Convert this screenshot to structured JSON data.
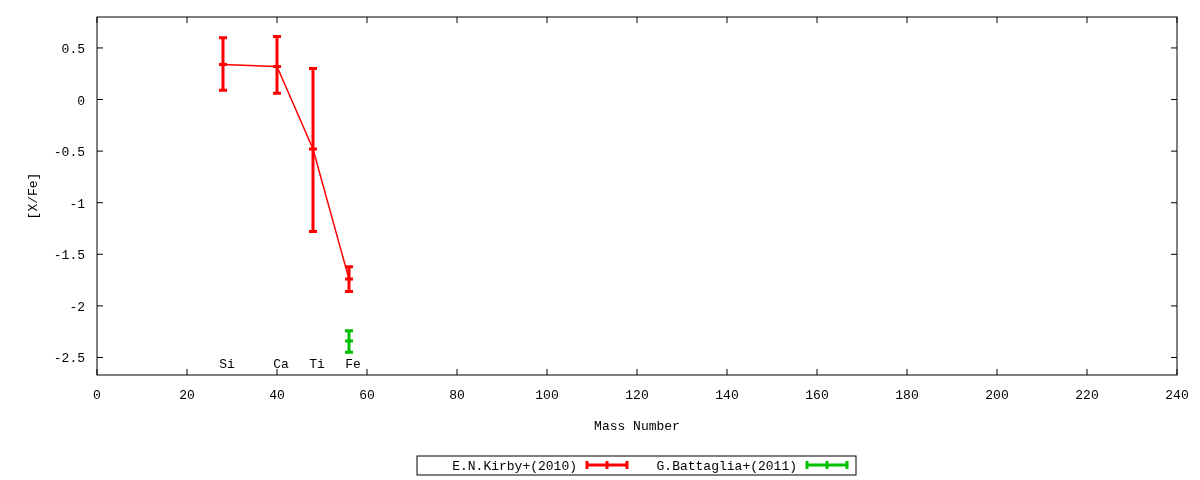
{
  "chart_data": {
    "type": "line",
    "xlabel": "Mass Number",
    "ylabel": "[X/Fe]",
    "x": [
      28,
      40,
      48,
      56
    ],
    "series": [
      {
        "name": "E.N.Kirby+(2010)",
        "color": "#ff0000",
        "marker": "square",
        "values": [
          0.34,
          0.32,
          -0.48,
          -1.74
        ],
        "errors": [
          [
            0.09,
            0.6
          ],
          [
            0.06,
            0.61
          ],
          [
            -1.28,
            0.3
          ],
          [
            -1.86,
            -1.62
          ]
        ]
      },
      {
        "name": "G.Battaglia+(2011)",
        "color": "#00c000",
        "marker": "square",
        "values": [
          null,
          null,
          null,
          -2.34
        ],
        "errors": [
          null,
          null,
          null,
          [
            -2.45,
            -2.24
          ]
        ]
      }
    ],
    "xlim": [
      0,
      240
    ],
    "ylim": [
      -2.67,
      0.8
    ],
    "xticks": [
      0,
      20,
      40,
      60,
      80,
      100,
      120,
      140,
      160,
      180,
      200,
      220,
      240
    ],
    "yticks": [
      {
        "value": 0.5,
        "label": "0.5"
      },
      {
        "value": 0,
        "label": "0"
      },
      {
        "value": -0.5,
        "label": "-0.5"
      },
      {
        "value": -1,
        "label": "-1"
      },
      {
        "value": -1.5,
        "label": "-1.5"
      },
      {
        "value": -2,
        "label": "-2"
      },
      {
        "value": -2.5,
        "label": "-2.5"
      }
    ],
    "annotations": [
      "Si",
      "Ca",
      "Ti",
      "Fe"
    ],
    "legend": "bottom"
  }
}
